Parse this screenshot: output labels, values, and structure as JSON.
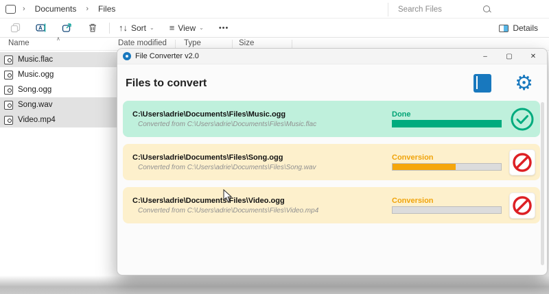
{
  "explorer": {
    "breadcrumb": {
      "separator": "›",
      "items": [
        "Documents",
        "Files"
      ]
    },
    "search": {
      "placeholder": "Search Files"
    },
    "toolbar": {
      "sort_label": "Sort",
      "view_label": "View",
      "more_label": "•••",
      "details_label": "Details",
      "sort_glyph": "↑↓",
      "view_glyph": "≡",
      "caret": "⌄"
    },
    "columns": {
      "name": "Name",
      "date_modified": "Date modified",
      "type": "Type",
      "size": "Size",
      "sort_indicator": "∧"
    },
    "files": [
      {
        "name": "Music.flac",
        "selected": true
      },
      {
        "name": "Music.ogg",
        "selected": false
      },
      {
        "name": "Song.ogg",
        "selected": false
      },
      {
        "name": "Song.wav",
        "selected": true
      },
      {
        "name": "Video.mp4",
        "selected": true
      }
    ]
  },
  "converter": {
    "title": "File Converter v2.0",
    "window_controls": {
      "minimize": "–",
      "maximize": "▢",
      "close": "✕"
    },
    "heading": "Files to convert",
    "gear_glyph": "⚙",
    "items": [
      {
        "output_path": "C:\\Users\\adrie\\Documents\\Files\\Music.ogg",
        "source_note": "Converted from  C:\\Users\\adrie\\Documents\\Files\\Music.flac",
        "status_label": "Done",
        "progress_percent": 100,
        "state": "done"
      },
      {
        "output_path": "C:\\Users\\adrie\\Documents\\Files\\Song.ogg",
        "source_note": "Converted from  C:\\Users\\adrie\\Documents\\Files\\Song.wav",
        "status_label": "Conversion",
        "progress_percent": 58,
        "state": "converting"
      },
      {
        "output_path": "C:\\Users\\adrie\\Documents\\Files\\Video.ogg",
        "source_note": "Converted from  C:\\Users\\adrie\\Documents\\Files\\Video.mp4",
        "status_label": "Conversion",
        "progress_percent": 0,
        "state": "converting"
      }
    ],
    "colors": {
      "done_green": "#00ab7e",
      "card_green": "#bff0dc",
      "card_yellow": "#fdf0cc",
      "conversion_orange": "#f0a30a",
      "cancel_red": "#dd2025",
      "accent_blue": "#1878be"
    }
  }
}
